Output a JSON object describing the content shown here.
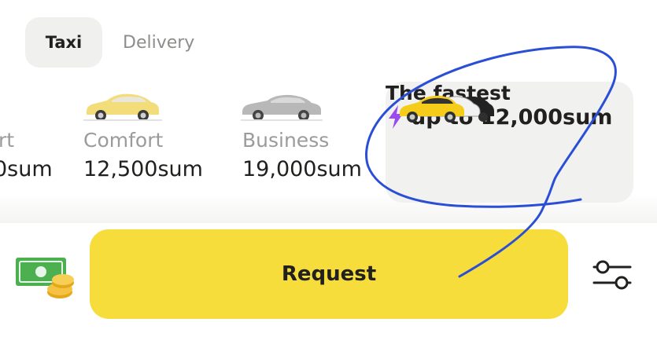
{
  "tabs": {
    "taxi": "Taxi",
    "delivery": "Delivery"
  },
  "tariffs": [
    {
      "name": "rt",
      "price": "0sum",
      "car_color": "#f5d03a"
    },
    {
      "name": "Comfort",
      "price": "12,500sum",
      "car_color": "#f3dd7a"
    },
    {
      "name": "Business",
      "price": "19,000sum",
      "car_color": "#b8b8b8"
    }
  ],
  "fastest": {
    "name": "The fastest",
    "price": "up to 12,000sum",
    "icon": "lightning-icon",
    "bolt_color": "#9b4cf0"
  },
  "bottom": {
    "request_label": "Request",
    "payment_icon": "cash-icon",
    "settings_icon": "settings-sliders-icon"
  },
  "colors": {
    "accent": "#f6dd3c",
    "annotation": "#2a4fd6"
  }
}
